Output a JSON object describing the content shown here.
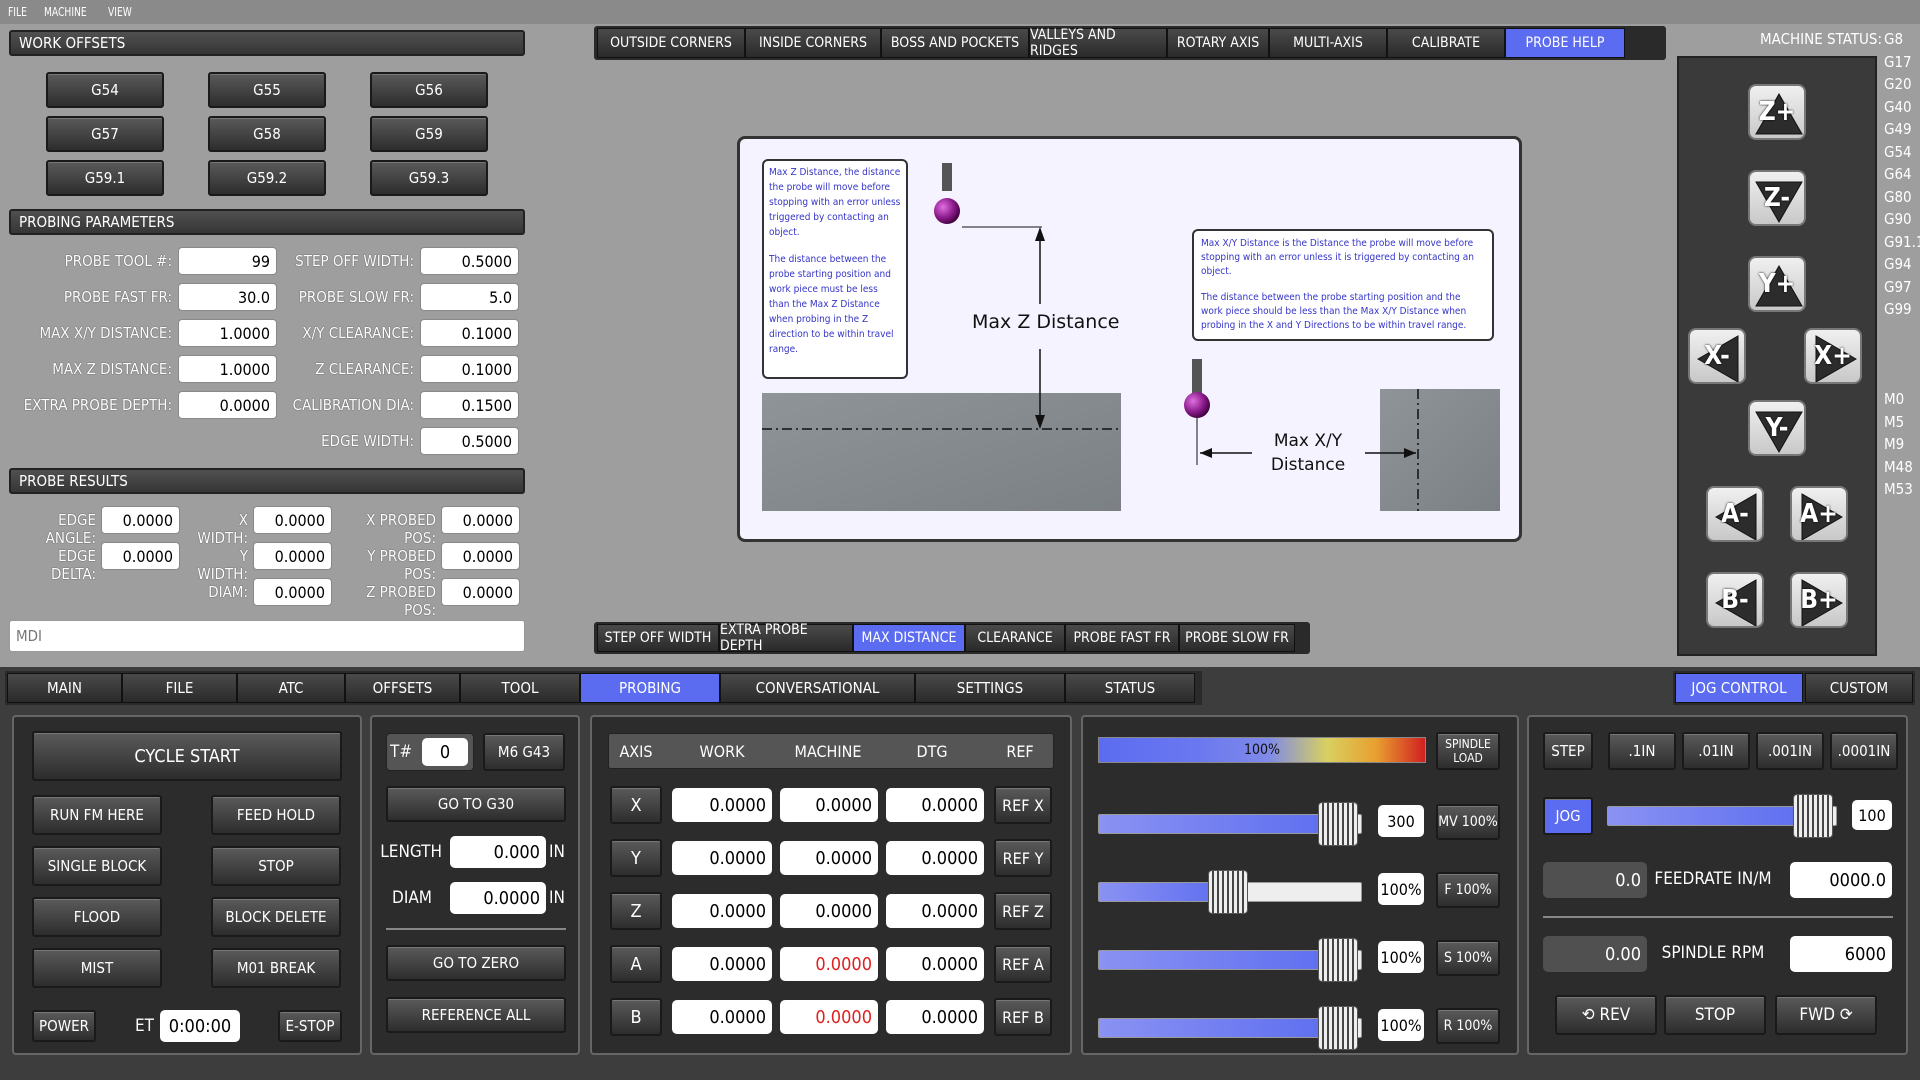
{
  "menu": [
    "FILE",
    "MACHINE",
    "VIEW"
  ],
  "work_offsets": {
    "title": "WORK OFFSETS",
    "buttons": [
      "G54",
      "G55",
      "G56",
      "G57",
      "G58",
      "G59",
      "G59.1",
      "G59.2",
      "G59.3"
    ]
  },
  "probing_params": {
    "title": "PROBING PARAMETERS",
    "left": [
      {
        "label": "PROBE TOOL #:",
        "value": "99"
      },
      {
        "label": "PROBE FAST FR:",
        "value": "30.0"
      },
      {
        "label": "MAX X/Y DISTANCE:",
        "value": "1.0000"
      },
      {
        "label": "MAX Z DISTANCE:",
        "value": "1.0000"
      },
      {
        "label": "EXTRA PROBE DEPTH:",
        "value": "0.0000"
      }
    ],
    "right": [
      {
        "label": "STEP OFF WIDTH:",
        "value": "0.5000"
      },
      {
        "label": "PROBE SLOW FR:",
        "value": "5.0"
      },
      {
        "label": "X/Y CLEARANCE:",
        "value": "0.1000"
      },
      {
        "label": "Z CLEARANCE:",
        "value": "0.1000"
      },
      {
        "label": "CALIBRATION DIA:",
        "value": "0.1500"
      },
      {
        "label": "EDGE WIDTH:",
        "value": "0.5000"
      }
    ]
  },
  "probe_results": {
    "title": "PROBE RESULTS",
    "col1": [
      {
        "label": "EDGE ANGLE:",
        "value": "0.0000"
      },
      {
        "label": "EDGE DELTA:",
        "value": "0.0000"
      }
    ],
    "col2": [
      {
        "label": "X WIDTH:",
        "value": "0.0000"
      },
      {
        "label": "Y WIDTH:",
        "value": "0.0000"
      },
      {
        "label": "DIAM:",
        "value": "0.0000"
      }
    ],
    "col3": [
      {
        "label": "X PROBED POS:",
        "value": "0.0000"
      },
      {
        "label": "Y PROBED POS:",
        "value": "0.0000"
      },
      {
        "label": "Z PROBED POS:",
        "value": "0.0000"
      }
    ]
  },
  "mdi_placeholder": "MDI",
  "probe_tabs": [
    "OUTSIDE CORNERS",
    "INSIDE CORNERS",
    "BOSS AND POCKETS",
    "VALLEYS AND RIDGES",
    "ROTARY AXIS",
    "MULTI-AXIS",
    "CALIBRATE",
    "PROBE HELP"
  ],
  "help_tabs": [
    "STEP OFF WIDTH",
    "EXTRA PROBE DEPTH",
    "MAX DISTANCE",
    "CLEARANCE",
    "PROBE FAST FR",
    "PROBE SLOW FR"
  ],
  "help": {
    "z_note_1": "Max Z Distance, the distance the probe will move before stopping with an error unless triggered by contacting an object.",
    "z_note_2": "The distance between the probe starting position and work piece must be less than the Max Z Distance when probing in the Z direction to be within travel range.",
    "z_label": "Max Z Distance",
    "xy_note_1": "Max X/Y Distance is the Distance the probe will move before stopping with an error unless it is triggered by contacting an object.",
    "xy_note_2": "The distance between the probe starting position and the work piece should be less than the Max X/Y Distance when probing in the X and Y Directions to be within travel range.",
    "xy_label_1": "Max X/Y",
    "xy_label_2": "Distance"
  },
  "status": {
    "title": "MACHINE STATUS:",
    "gcodes": [
      "G8",
      "G17",
      "G20",
      "G40",
      "G49",
      "G54",
      "G64",
      "G80",
      "G90",
      "G91.1",
      "G94",
      "G97",
      "G99"
    ],
    "mcodes": [
      "M0",
      "M5",
      "M9",
      "M48",
      "M53"
    ]
  },
  "jog_buttons": [
    "Z+",
    "Z-",
    "Y+",
    "X-",
    "X+",
    "Y-",
    "A-",
    "A+",
    "B-",
    "B+"
  ],
  "main_tabs": [
    "MAIN",
    "FILE",
    "ATC",
    "OFFSETS",
    "TOOL",
    "PROBING",
    "CONVERSATIONAL",
    "SETTINGS",
    "STATUS"
  ],
  "right_tabs": [
    "JOG CONTROL",
    "CUSTOM"
  ],
  "cycle": {
    "start": "CYCLE START",
    "run_fm_here": "RUN FM HERE",
    "feed_hold": "FEED HOLD",
    "single_block": "SINGLE BLOCK",
    "stop": "STOP",
    "flood": "FLOOD",
    "block_delete": "BLOCK DELETE",
    "mist": "MIST",
    "m01_break": "M01 BREAK",
    "power": "POWER",
    "et_label": "ET",
    "et_value": "0:00:00",
    "estop": "E-STOP"
  },
  "tool": {
    "t_label": "T#",
    "t_value": "0",
    "m6": "M6 G43",
    "goto_g30": "GO TO G30",
    "length_label": "LENGTH",
    "length_value": "0.000",
    "length_unit": "IN",
    "diam_label": "DIAM",
    "diam_value": "0.0000",
    "diam_unit": "IN",
    "goto_zero": "GO TO ZERO",
    "reference_all": "REFERENCE ALL"
  },
  "dro": {
    "headers": [
      "AXIS",
      "WORK",
      "MACHINE",
      "DTG",
      "REF"
    ],
    "rows": [
      {
        "axis": "X",
        "work": "0.0000",
        "machine": "0.0000",
        "dtg": "0.0000",
        "ref": "REF X",
        "warn": false
      },
      {
        "axis": "Y",
        "work": "0.0000",
        "machine": "0.0000",
        "dtg": "0.0000",
        "ref": "REF Y",
        "warn": false
      },
      {
        "axis": "Z",
        "work": "0.0000",
        "machine": "0.0000",
        "dtg": "0.0000",
        "ref": "REF Z",
        "warn": false
      },
      {
        "axis": "A",
        "work": "0.0000",
        "machine": "0.0000",
        "dtg": "0.0000",
        "ref": "REF A",
        "warn": true
      },
      {
        "axis": "B",
        "work": "0.0000",
        "machine": "0.0000",
        "dtg": "0.0000",
        "ref": "REF B",
        "warn": true
      }
    ]
  },
  "overrides": {
    "spindle_load_label": "100%",
    "spindle_load_btn_1": "SPINDLE",
    "spindle_load_btn_2": "LOAD",
    "rows": [
      {
        "value": "300",
        "btn": "MV 100%",
        "level": 1.0
      },
      {
        "value": "100%",
        "btn": "F 100%",
        "level": 0.5
      },
      {
        "value": "100%",
        "btn": "S 100%",
        "level": 1.0
      },
      {
        "value": "100%",
        "btn": "R 100%",
        "level": 1.0
      }
    ]
  },
  "jog": {
    "step": "STEP",
    "increments": [
      ".1IN",
      ".01IN",
      ".001IN",
      ".0001IN"
    ],
    "jog": "JOG",
    "jog_value": "100",
    "jog_level": 1.0,
    "feed_actual": "0.0",
    "feed_label": "FEEDRATE IN/M",
    "feed_value": "0000.0",
    "rpm_actual": "0.00",
    "rpm_label": "SPINDLE RPM",
    "rpm_value": "6000",
    "rev": "⟲ REV",
    "stop": "STOP",
    "fwd": "FWD ⟳"
  },
  "colors": {
    "accent": "#5b6cf0",
    "warn_text": "#e02020"
  }
}
